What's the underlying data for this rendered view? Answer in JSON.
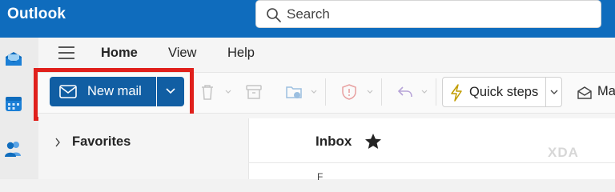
{
  "header": {
    "app_title": "Outlook",
    "search_placeholder": "Search"
  },
  "nav": {
    "tabs": [
      {
        "label": "Home",
        "selected": true
      },
      {
        "label": "View",
        "selected": false
      },
      {
        "label": "Help",
        "selected": false
      }
    ]
  },
  "rail": {
    "items": [
      {
        "icon": "mail-icon"
      },
      {
        "icon": "calendar-icon"
      },
      {
        "icon": "people-icon"
      }
    ]
  },
  "toolbar": {
    "new_mail_label": "New mail",
    "quick_steps_label": "Quick steps",
    "mark_label_partial": "Ma",
    "icons": [
      "delete-icon",
      "archive-icon",
      "move-to-folder-icon",
      "report-icon",
      "reply-icon",
      "quick-steps-icon",
      "mark-read-icon"
    ]
  },
  "folder_pane": {
    "favorites_label": "Favorites"
  },
  "message_list": {
    "title": "Inbox",
    "partial_row_text": "F"
  },
  "watermark": {
    "text": "XDA"
  },
  "colors": {
    "brand_blue": "#0f6cbd",
    "button_blue": "#115ea3",
    "highlight_red": "#e0201c"
  }
}
